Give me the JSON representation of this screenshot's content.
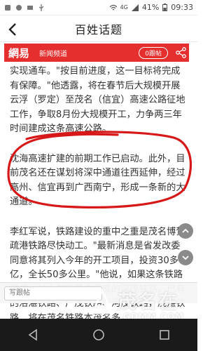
{
  "status_bar": {
    "left_icons": [
      "notification-icon",
      "notification-icon",
      "notification-icon",
      "usb-icon"
    ],
    "signal": "4G",
    "battery": "41%",
    "time": "09:33"
  },
  "title_bar": {
    "back_icon": "chevron-left-icon",
    "title": "百姓话题"
  },
  "news_header": {
    "brand": "網易",
    "channel": "新闻频道",
    "follow_label": "0跟帖",
    "share_icon": "share-icon",
    "color": "#e52e2e"
  },
  "article": {
    "p1": "实现通车。\"按目前进度，这一目标将完成有保障。\"他透露，将在春节后大规模开展云浮（罗定）至茂名（信宜）高速公路征地工作，争取8月份大规模开工，力争两三年时间建成这条高速公路。",
    "p2": "沈海高速扩建的前期工作已启动。此外，目前茂名还在谋划将深中通道往西延伸，经过高州、信宜再到广西南宁，形成一条新的大通道。",
    "p3": "李红军说，铁路建设的重中之重是茂名博贺疏港铁路尽快动工。\"最新消息是省发改委同意将其列入今年的开工项目，投资30多个亿，全长50多公里。\"他说，如果这条铁路建成，加上年底基本建成的深茂铁路，已有的洛湛铁路、广茂铁路、河茂铁路，茂湛铁路，将在茂名铁路本茂名多"
  },
  "bottom_bar": {
    "comment_placeholder": "写跟帖"
  },
  "watermark": {
    "name": "茂名在线",
    "url": "GDMM.COM"
  },
  "colors": {
    "annotation_ellipse": "#d61818",
    "float_button": "#8a8a8a"
  }
}
